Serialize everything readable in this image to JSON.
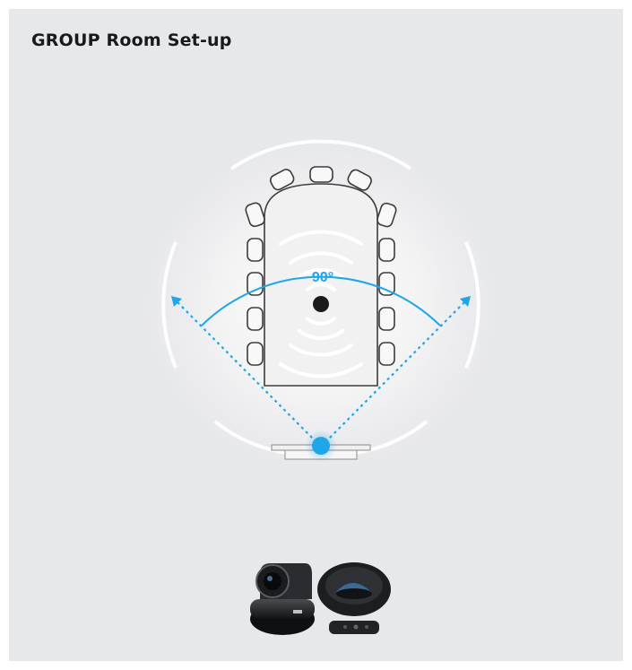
{
  "header": {
    "title": "GROUP Room Set-up"
  },
  "diagram": {
    "field_of_view_label": "90°",
    "accent_color": "#1fa6e8",
    "table_seats_per_long_side": 5,
    "table_seats_at_far_end": 3
  },
  "products": {
    "icons": [
      "ptz-camera-icon",
      "speakerphone-icon",
      "remote-control-icon"
    ]
  }
}
